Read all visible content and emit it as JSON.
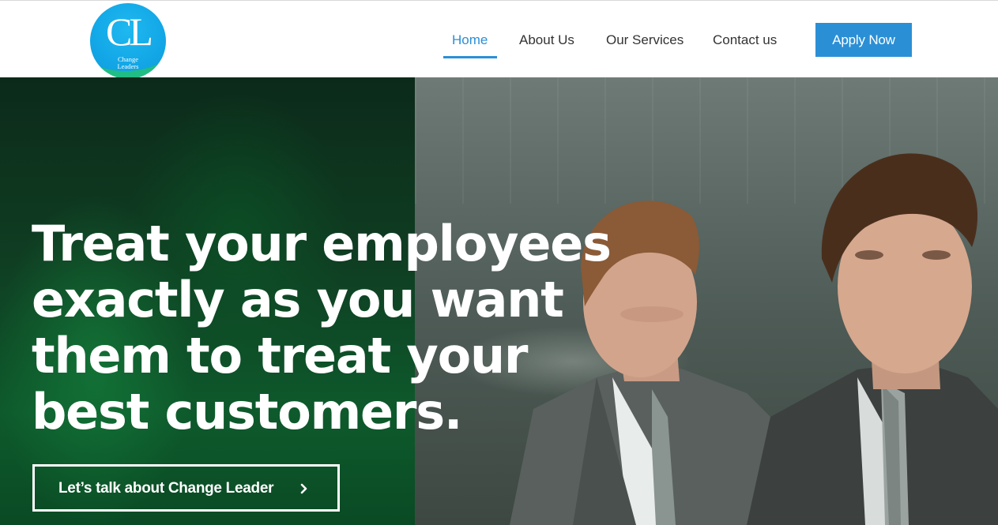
{
  "logo": {
    "letters": "CL",
    "tagline_line1": "Change",
    "tagline_line2": "Leaders",
    "icon": "change-leaders-logo"
  },
  "nav": {
    "items": [
      {
        "label": "Home",
        "active": true
      },
      {
        "label": "About Us",
        "active": false
      },
      {
        "label": "Our Services",
        "active": false
      },
      {
        "label": "Contact us",
        "active": false
      }
    ],
    "apply_label": "Apply Now"
  },
  "hero": {
    "headline_lines": [
      "Treat your employees",
      "exactly as you want",
      "them to treat your",
      "best customers."
    ],
    "cta_label": "Let’s talk about Change Leader",
    "cta_icon": "chevron-right-icon"
  },
  "colors": {
    "accent": "#2b8fd6",
    "logo_blue": "#12a6e6",
    "hero_green": "#0e5a2c",
    "text_dark": "#333333"
  }
}
